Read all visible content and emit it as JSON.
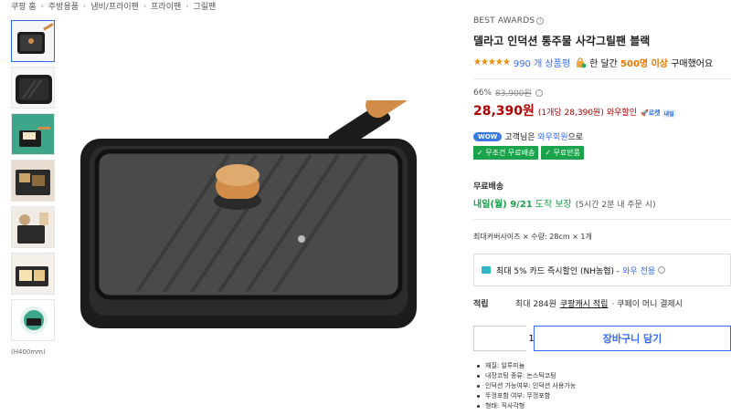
{
  "breadcrumb": [
    "쿠팡 홈",
    "주방용품",
    "냄비/프라이팬",
    "프라이팬",
    "그릴팬"
  ],
  "thumbs": {
    "caption": "(H400mm)"
  },
  "product": {
    "best_awards": "BEST AWARDS",
    "title": "델라고 인덕션 통주물 사각그릴팬 블랙",
    "stars": "★★★★★",
    "rating": 4.5,
    "review_count": "990 개 상품평",
    "sold_prefix": "한 달간",
    "sold_highlight": "500명 이상",
    "sold_suffix": "구매했어요"
  },
  "pricing": {
    "discount_rate": "66%",
    "original_price": "83,900원",
    "price": "28,390원",
    "unit_price": "(1개당 28,390원)",
    "wow_discount": "와우할인",
    "rocket_label": "로켓",
    "rocket_tomorrow": "내일"
  },
  "wow": {
    "badge": "WOW",
    "prefix": "고객님은",
    "member": "와우회원",
    "suffix": "으로",
    "benefit_shipping": "✓ 무조건 무료배송",
    "benefit_return": "✓ 무료반품"
  },
  "shipping": {
    "label": "무료배송",
    "date": "내일(월) 9/21",
    "guarantee": "도착 보장",
    "cutoff": "(5시간 2분 내 주문 시)"
  },
  "option": {
    "text": "최대커버사이즈 × 수량: 28cm × 1개"
  },
  "card": {
    "text": "최대 5% 카드 즉시할인 (NH농협) -",
    "wow": "와우 전용"
  },
  "cashback": {
    "label": "적립",
    "prefix": "최대 284원",
    "link": "쿠팡캐시 적립",
    "suffix": "· 쿠페이 머니 결제시"
  },
  "purchase": {
    "quantity": "1",
    "cart_label": "장바구니 담기"
  },
  "specs": [
    "재질: 알루미늄",
    "내장코팅 종류: 논스틱코팅",
    "인덕션 가능여부: 인덕션 사용가능",
    "뚜껑포함 여부: 뚜껑포함",
    "형태: 직사각형"
  ],
  "colors": {
    "accent_blue": "#346aff",
    "price_red": "#ae0000",
    "benefit_green": "#19a34a",
    "pan_black": "#1c1c1c",
    "handle_wood": "#d08c48"
  }
}
